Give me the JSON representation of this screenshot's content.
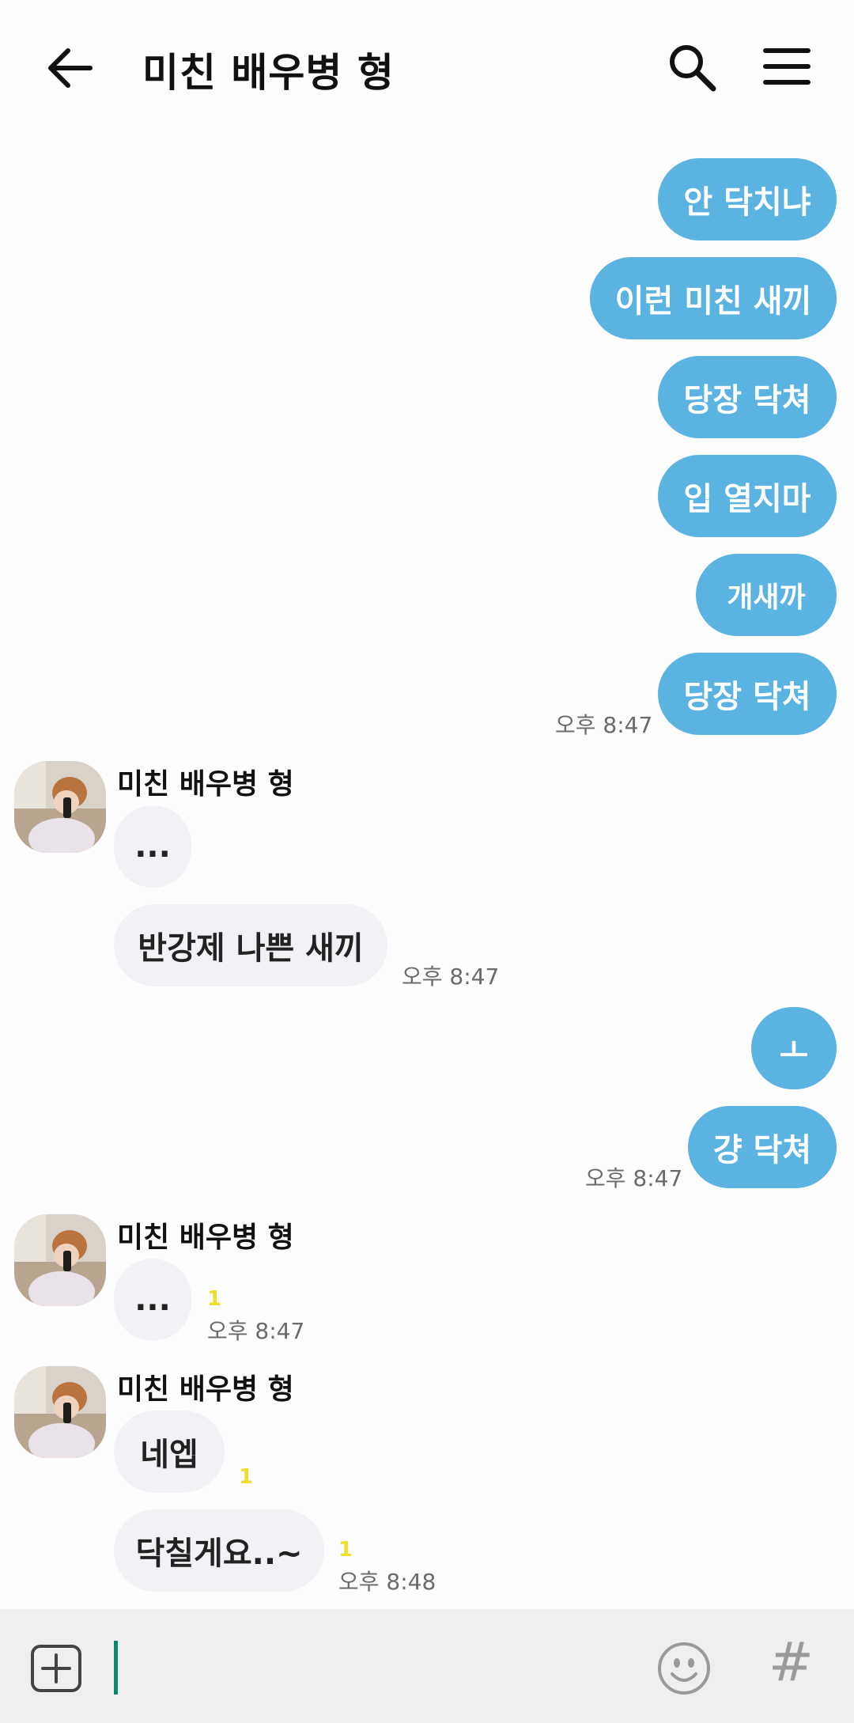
{
  "header": {
    "title": "미친 배우병 형"
  },
  "messages": {
    "m1": "안 닥치냐",
    "m2": "이런 미친 새끼",
    "m3": "당장 닥쳐",
    "m4": "입 열지마",
    "m5": "개새까",
    "m6": "당장 닥쳐",
    "t1": "오후 8:47",
    "sender1": "미친 배우병 형",
    "m7": "...",
    "m8": "반강제 나쁜 새끼",
    "t2": "오후 8:47",
    "m9": "ㅗ",
    "m10": "걍 닥쳐",
    "t3": "오후 8:47",
    "sender2": "미친 배우병 형",
    "m11": "...",
    "u1": "1",
    "t4": "오후 8:47",
    "sender3": "미친 배우병 형",
    "m12": "네엡",
    "u2": "1",
    "m13": "닥칠게요..~",
    "u3": "1",
    "t5": "오후 8:48"
  },
  "colors": {
    "my_bubble": "#5bb3e2",
    "their_bubble": "#f2f2f6",
    "unread": "#f2dc2c",
    "cursor": "#0a8a6b"
  },
  "icons": {
    "back": "arrow-left-icon",
    "search": "search-icon",
    "menu": "hamburger-menu-icon",
    "attach": "plus-square-icon",
    "emoji": "smiley-icon",
    "hashtag": "hashtag-icon"
  }
}
